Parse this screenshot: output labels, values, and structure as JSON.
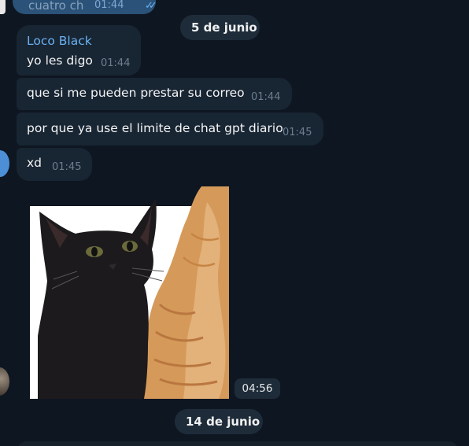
{
  "top_message": {
    "text": "cuatro ch",
    "time": "01:44"
  },
  "date_separators": [
    "5 de junio",
    "14 de junio"
  ],
  "messages": [
    {
      "sender": "Loco Black",
      "text": "yo les digo",
      "time": "01:44"
    },
    {
      "text": "que si me pueden prestar su correo",
      "time": "01:44"
    },
    {
      "text": "por que ya use el limite de chat gpt diario",
      "time": "01:45"
    },
    {
      "text": "xd",
      "time": "01:45"
    }
  ],
  "sticker": {
    "description_icon": "black-cat-and-orange-cat-sticker",
    "time": "04:56"
  },
  "colors": {
    "background": "#0e1621",
    "incoming_bubble": "#182533",
    "outgoing_bubble": "#2b5278",
    "sender_name": "#6ab2f2",
    "timestamp": "#6d7f8f"
  }
}
